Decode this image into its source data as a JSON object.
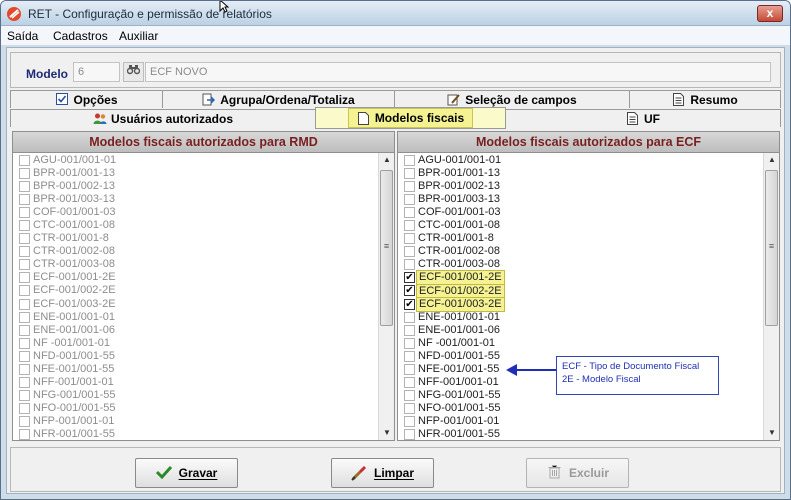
{
  "window": {
    "title": "RET - Configuração e permissão de relatórios",
    "close_glyph": "x",
    "colors": {
      "title_bg": "#cfdde9",
      "accent_red": "#c44a35",
      "header_text": "#7a1f1f",
      "highlight": "#f4f292",
      "callout_blue": "#1f2fb5"
    }
  },
  "menu": {
    "items": [
      "Saída",
      "Cadastros",
      "Auxiliar"
    ]
  },
  "model": {
    "label": "Modelo",
    "number": "6",
    "name": "ECF NOVO",
    "search_icon": "binoculars-icon"
  },
  "tabs": {
    "row1": [
      {
        "label": "Opções",
        "icon": "checkbox-icon"
      },
      {
        "label": "Agrupa/Ordena/Totaliza",
        "icon": "arrow-doc-icon"
      },
      {
        "label": "Seleção de campos",
        "icon": "pencil-icon"
      },
      {
        "label": "Resumo",
        "icon": "document-icon"
      }
    ],
    "row2": [
      {
        "label": "Usuários autorizados",
        "icon": "users-icon"
      },
      {
        "label": "Modelos fiscais",
        "icon": "page-icon"
      },
      {
        "label": "UF",
        "icon": "document-icon"
      }
    ],
    "active": "Modelos fiscais"
  },
  "left_list": {
    "title": "Modelos fiscais autorizados para RMD",
    "items": [
      "AGU-001/001-01",
      "BPR-001/001-13",
      "BPR-001/002-13",
      "BPR-001/003-13",
      "COF-001/001-03",
      "CTC-001/001-08",
      "CTR-001/001-8",
      "CTR-001/002-08",
      "CTR-001/003-08",
      "ECF-001/001-2E",
      "ECF-001/002-2E",
      "ECF-001/003-2E",
      "ENE-001/001-01",
      "ENE-001/001-06",
      "NF -001/001-01",
      "NFD-001/001-55",
      "NFE-001/001-55",
      "NFF-001/001-01",
      "NFG-001/001-55",
      "NFO-001/001-55",
      "NFP-001/001-01",
      "NFR-001/001-55"
    ]
  },
  "right_list": {
    "title": "Modelos fiscais autorizados para ECF",
    "items": [
      "AGU-001/001-01",
      "BPR-001/001-13",
      "BPR-001/002-13",
      "BPR-001/003-13",
      "COF-001/001-03",
      "CTC-001/001-08",
      "CTR-001/001-8",
      "CTR-001/002-08",
      "CTR-001/003-08",
      "ECF-001/001-2E",
      "ECF-001/002-2E",
      "ECF-001/003-2E",
      "ENE-001/001-01",
      "ENE-001/001-06",
      "NF -001/001-01",
      "NFD-001/001-55",
      "NFE-001/001-55",
      "NFF-001/001-01",
      "NFG-001/001-55",
      "NFO-001/001-55",
      "NFP-001/001-01",
      "NFR-001/001-55"
    ],
    "checked": [
      "ECF-001/001-2E",
      "ECF-001/002-2E",
      "ECF-001/003-2E"
    ]
  },
  "callout": {
    "line1": "ECF - Tipo de Documento Fiscal",
    "line2": "2E - Modelo Fiscal"
  },
  "buttons": {
    "save": "Gravar",
    "clear": "Limpar",
    "delete": "Excluir"
  }
}
